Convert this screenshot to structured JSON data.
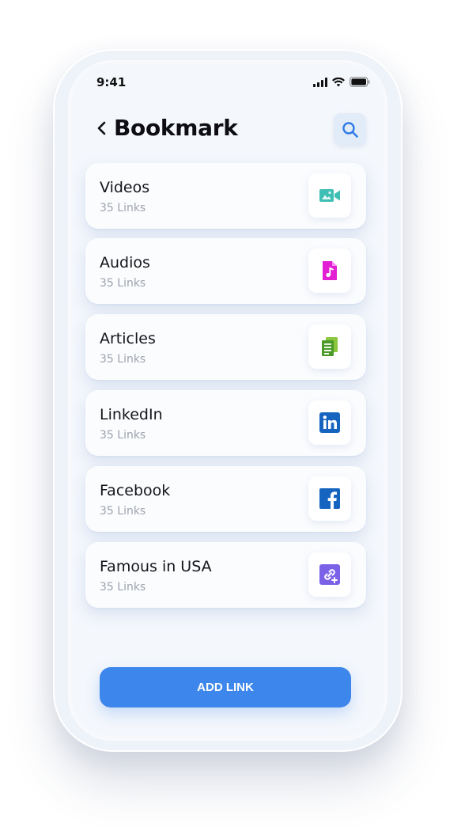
{
  "status_bar": {
    "time": "9:41"
  },
  "header": {
    "title": "Bookmark"
  },
  "items": [
    {
      "title": "Videos",
      "subtitle": "35 Links",
      "icon": "video-camera-icon",
      "icon_color": "#3fbfb4"
    },
    {
      "title": "Audios",
      "subtitle": "35 Links",
      "icon": "music-file-icon",
      "icon_color": "#e21fd2"
    },
    {
      "title": "Articles",
      "subtitle": "35 Links",
      "icon": "documents-icon",
      "icon_color": "#5aa230"
    },
    {
      "title": "LinkedIn",
      "subtitle": "35 Links",
      "icon": "linkedin-icon",
      "icon_color": "#1565c0"
    },
    {
      "title": "Facebook",
      "subtitle": "35 Links",
      "icon": "facebook-icon",
      "icon_color": "#1565c0"
    },
    {
      "title": "Famous in USA",
      "subtitle": "35 Links",
      "icon": "add-link-icon",
      "icon_color": "#7b61e8"
    }
  ],
  "actions": {
    "add_link_label": "ADD LINK"
  },
  "colors": {
    "accent": "#3d86eb",
    "search_bg": "#e2ebf8"
  }
}
